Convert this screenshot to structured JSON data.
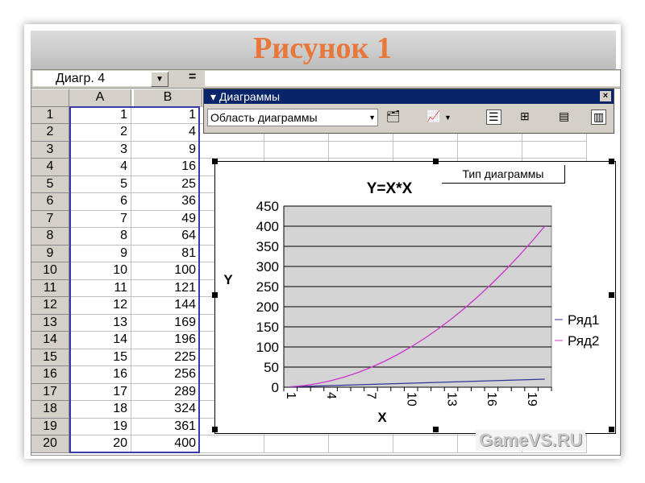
{
  "slide": {
    "title": "Рисунок 1",
    "watermark": "GameVS.RU"
  },
  "excel": {
    "name_box": "Диагр. 4",
    "formula_eq": "=",
    "columns": [
      "A",
      "B"
    ],
    "rows": [
      [
        1,
        1
      ],
      [
        2,
        4
      ],
      [
        3,
        9
      ],
      [
        4,
        16
      ],
      [
        5,
        25
      ],
      [
        6,
        36
      ],
      [
        7,
        49
      ],
      [
        8,
        64
      ],
      [
        9,
        81
      ],
      [
        10,
        100
      ],
      [
        11,
        121
      ],
      [
        12,
        144
      ],
      [
        13,
        169
      ],
      [
        14,
        196
      ],
      [
        15,
        225
      ],
      [
        16,
        256
      ],
      [
        17,
        289
      ],
      [
        18,
        324
      ],
      [
        19,
        361
      ],
      [
        20,
        400
      ]
    ]
  },
  "toolbar": {
    "title": "Диаграммы",
    "close": "×",
    "area_select": "Область диаграммы",
    "tooltip": "Тип диаграммы"
  },
  "chart_data": {
    "type": "line",
    "title": "Y=X*X",
    "xlabel": "X",
    "ylabel": "Y",
    "categories": [
      1,
      2,
      3,
      4,
      5,
      6,
      7,
      8,
      9,
      10,
      11,
      12,
      13,
      14,
      15,
      16,
      17,
      18,
      19,
      20
    ],
    "x_tick_labels": [
      "1",
      "4",
      "7",
      "10",
      "13",
      "16",
      "19"
    ],
    "y_ticks": [
      "0",
      "50",
      "100",
      "150",
      "200",
      "250",
      "300",
      "350",
      "400",
      "450"
    ],
    "ylim": [
      0,
      450
    ],
    "grid": true,
    "legend": "right",
    "series": [
      {
        "name": "Ряд1",
        "color": "#333399",
        "values": [
          1,
          2,
          3,
          4,
          5,
          6,
          7,
          8,
          9,
          10,
          11,
          12,
          13,
          14,
          15,
          16,
          17,
          18,
          19,
          20
        ]
      },
      {
        "name": "Ряд2",
        "color": "#cc33cc",
        "values": [
          1,
          4,
          9,
          16,
          25,
          36,
          49,
          64,
          81,
          100,
          121,
          144,
          169,
          196,
          225,
          256,
          289,
          324,
          361,
          400
        ]
      }
    ]
  }
}
